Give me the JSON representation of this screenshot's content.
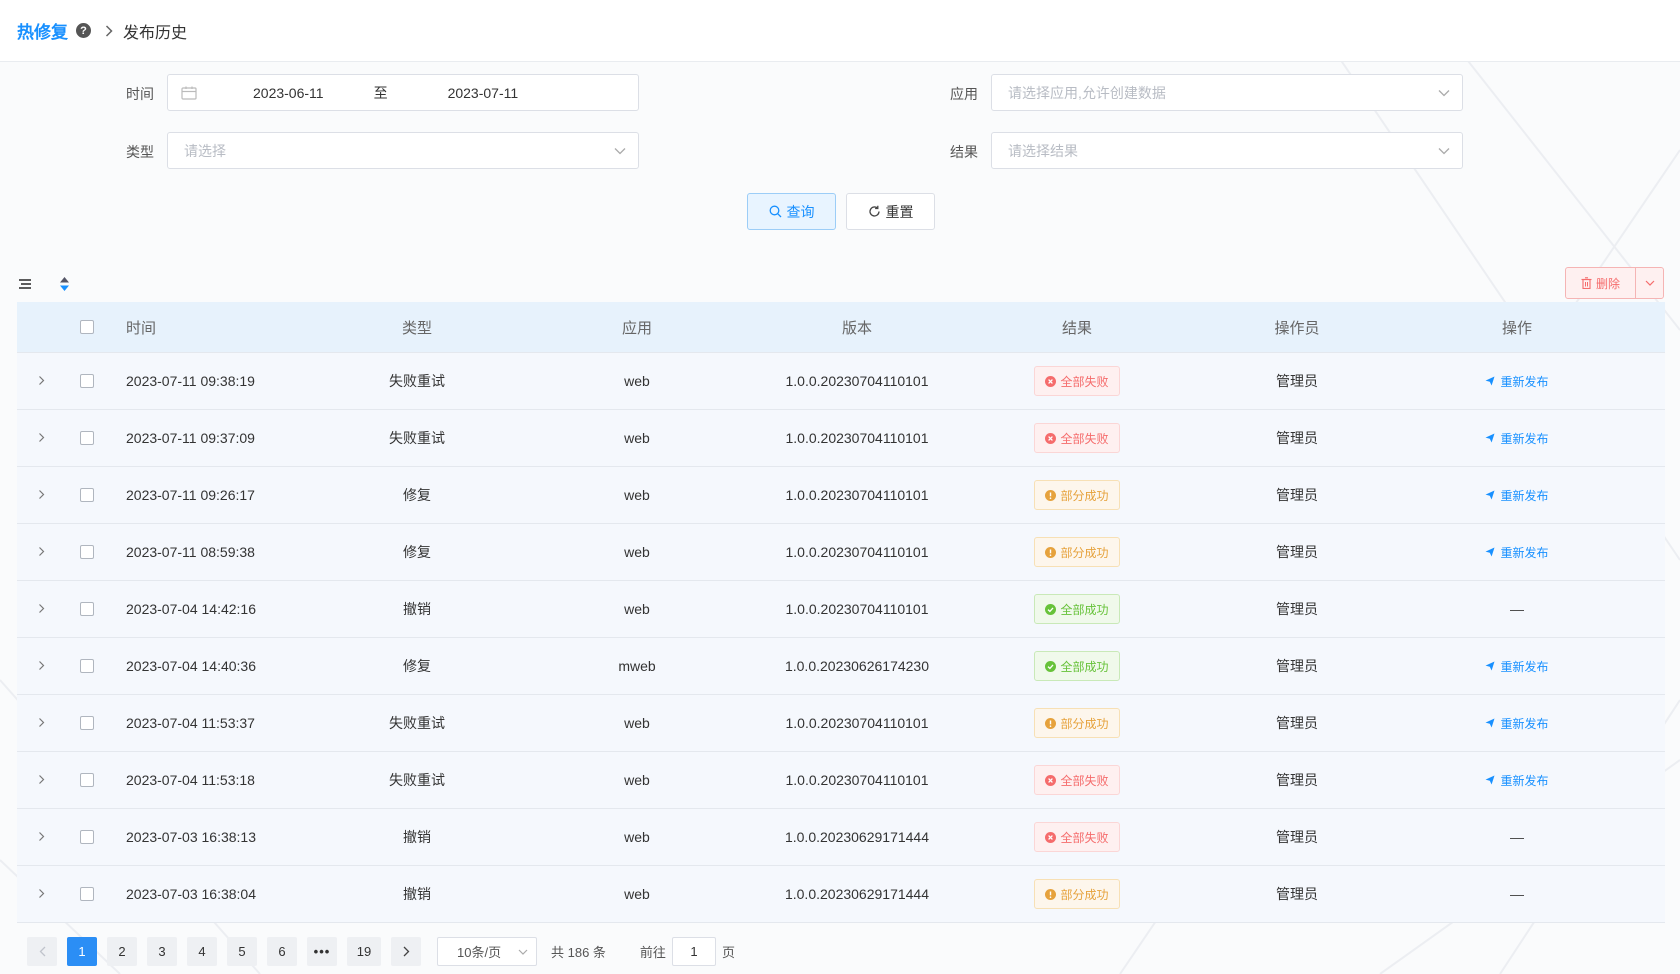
{
  "breadcrumb": {
    "root": "热修复",
    "current": "发布历史"
  },
  "filters": {
    "time_label": "时间",
    "start_date": "2023-06-11",
    "range_sep": "至",
    "end_date": "2023-07-11",
    "app_label": "应用",
    "app_placeholder": "请选择应用,允许创建数据",
    "type_label": "类型",
    "type_placeholder": "请选择",
    "result_label": "结果",
    "result_placeholder": "请选择结果",
    "query_label": "查询",
    "reset_label": "重置"
  },
  "toolbar": {
    "delete_label": "删除"
  },
  "table": {
    "columns": [
      "时间",
      "类型",
      "应用",
      "版本",
      "结果",
      "操作员",
      "操作"
    ],
    "action_label": "重新发布",
    "rows": [
      {
        "time": "2023-07-11 09:38:19",
        "type": "失败重试",
        "app": "web",
        "version": "1.0.0.20230704110101",
        "result": "全部失败",
        "operator": "管理员",
        "action": "重新发布"
      },
      {
        "time": "2023-07-11 09:37:09",
        "type": "失败重试",
        "app": "web",
        "version": "1.0.0.20230704110101",
        "result": "全部失败",
        "operator": "管理员",
        "action": "重新发布"
      },
      {
        "time": "2023-07-11 09:26:17",
        "type": "修复",
        "app": "web",
        "version": "1.0.0.20230704110101",
        "result": "部分成功",
        "operator": "管理员",
        "action": "重新发布"
      },
      {
        "time": "2023-07-11 08:59:38",
        "type": "修复",
        "app": "web",
        "version": "1.0.0.20230704110101",
        "result": "部分成功",
        "operator": "管理员",
        "action": "重新发布"
      },
      {
        "time": "2023-07-04 14:42:16",
        "type": "撤销",
        "app": "web",
        "version": "1.0.0.20230704110101",
        "result": "全部成功",
        "operator": "管理员",
        "action": "—"
      },
      {
        "time": "2023-07-04 14:40:36",
        "type": "修复",
        "app": "mweb",
        "version": "1.0.0.20230626174230",
        "result": "全部成功",
        "operator": "管理员",
        "action": "重新发布"
      },
      {
        "time": "2023-07-04 11:53:37",
        "type": "失败重试",
        "app": "web",
        "version": "1.0.0.20230704110101",
        "result": "部分成功",
        "operator": "管理员",
        "action": "重新发布"
      },
      {
        "time": "2023-07-04 11:53:18",
        "type": "失败重试",
        "app": "web",
        "version": "1.0.0.20230704110101",
        "result": "全部失败",
        "operator": "管理员",
        "action": "重新发布"
      },
      {
        "time": "2023-07-03 16:38:13",
        "type": "撤销",
        "app": "web",
        "version": "1.0.0.20230629171444",
        "result": "全部失败",
        "operator": "管理员",
        "action": "—"
      },
      {
        "time": "2023-07-03 16:38:04",
        "type": "撤销",
        "app": "web",
        "version": "1.0.0.20230629171444",
        "result": "部分成功",
        "operator": "管理员",
        "action": "—"
      }
    ]
  },
  "pagination": {
    "pages": [
      "1",
      "2",
      "3",
      "4",
      "5",
      "6"
    ],
    "more": "•••",
    "last_page": "19",
    "current_page": 1,
    "page_size": "10条/页",
    "total": "共 186 条",
    "goto_prefix": "前往",
    "goto_value": "1",
    "goto_suffix": "页"
  },
  "colors": {
    "primary": "#1890ff",
    "fail": "#f56c6c",
    "partial": "#e6a23c",
    "success": "#67c23a"
  },
  "icons": {
    "help": "question-circle-icon",
    "breadcrumb_sep": "chevron-right-icon",
    "calendar": "calendar-icon",
    "dropdown": "chevron-down-icon",
    "query": "search-icon",
    "reset": "refresh-icon",
    "columns": "list-icon",
    "sort": "sort-icon",
    "delete": "trash-icon",
    "expand": "chevron-right-icon",
    "fail": "close-circle-icon",
    "partial": "warning-circle-icon",
    "success": "check-circle-icon",
    "action": "send-icon"
  }
}
